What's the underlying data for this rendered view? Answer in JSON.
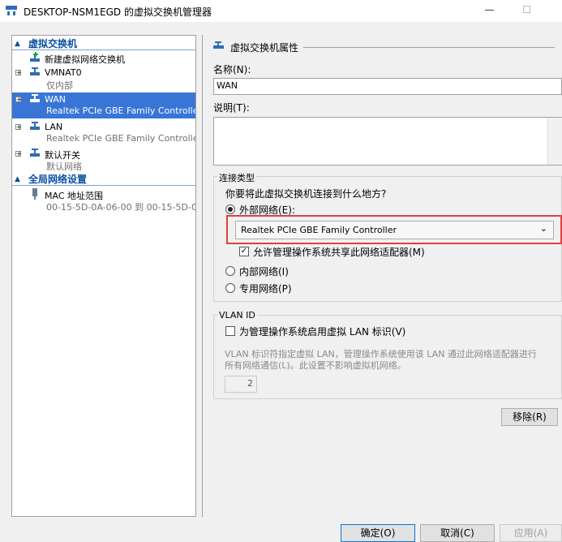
{
  "window": {
    "title": "DESKTOP-NSM1EGD 的虚拟交换机管理器"
  },
  "sidebar": {
    "section1": "虚拟交换机",
    "new_switch": "新建虚拟网络交换机",
    "items": [
      {
        "name": "VMNAT0",
        "sub": "仅内部"
      },
      {
        "name": "WAN",
        "sub": "Realtek PCIe GBE Family Controller"
      },
      {
        "name": "LAN",
        "sub": "Realtek PCIe GBE Family Controller..."
      },
      {
        "name": "默认开关",
        "sub": "默认网络"
      }
    ],
    "section2": "全局网络设置",
    "mac": {
      "name": "MAC 地址范围",
      "sub": "00-15-5D-0A-06-00 到 00-15-5D-0..."
    }
  },
  "panel": {
    "title": "虚拟交换机属性",
    "name_label": "名称(N):",
    "name_value": "WAN",
    "notes_label": "说明(T):",
    "notes_value": "",
    "conn_group": "连接类型",
    "conn_question": "你要将此虚拟交换机连接到什么地方?",
    "external_label": "外部网络(E):",
    "adapter_selected": "Realtek PCIe GBE Family Controller",
    "allow_share_label": "允许管理操作系统共享此网络适配器(M)",
    "internal_label": "内部网络(I)",
    "private_label": "专用网络(P)",
    "vlan_group": "VLAN ID",
    "vlan_enable_label": "为管理操作系统启用虚拟 LAN 标识(V)",
    "vlan_desc_line1": "VLAN 标识符指定虚拟 LAN，管理操作系统使用该 LAN 通过此网络适配器进行",
    "vlan_desc_line2": "所有网络通信(L)。此设置不影响虚拟机网络。",
    "vlan_value": "2",
    "remove_label": "移除(R)"
  },
  "footer": {
    "ok": "确定(O)",
    "cancel": "取消(C)",
    "apply": "应用(A)"
  },
  "state": {
    "connection": "external",
    "allow_share": true,
    "vlan_enabled": false,
    "selected_switch": "WAN"
  }
}
